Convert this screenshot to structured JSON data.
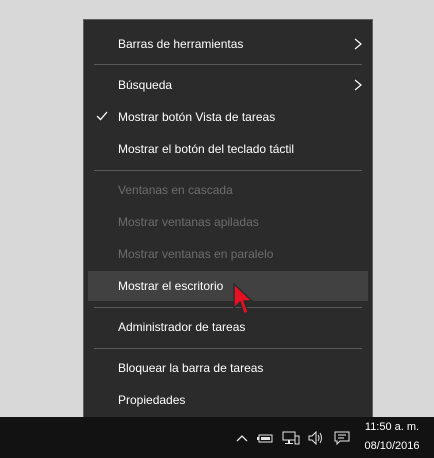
{
  "menu": {
    "items": [
      {
        "label": "Barras de herramientas",
        "submenu": true
      },
      {
        "label": "Búsqueda",
        "submenu": true
      },
      {
        "label": "Mostrar botón Vista de tareas",
        "checked": true
      },
      {
        "label": "Mostrar el botón del teclado táctil"
      },
      {
        "label": "Ventanas en cascada",
        "disabled": true
      },
      {
        "label": "Mostrar ventanas apiladas",
        "disabled": true
      },
      {
        "label": "Mostrar ventanas en paralelo",
        "disabled": true
      },
      {
        "label": "Mostrar el escritorio",
        "highlighted": true
      },
      {
        "label": "Administrador de tareas"
      },
      {
        "label": "Bloquear la barra de tareas"
      },
      {
        "label": "Propiedades"
      }
    ]
  },
  "taskbar": {
    "clock": {
      "time": "11:50 a. m.",
      "date": "08/10/2016"
    },
    "tray_icons": [
      "chevron-up-icon",
      "battery-icon",
      "network-icon",
      "volume-icon",
      "notifications-icon"
    ]
  },
  "colors": {
    "menu_bg": "#2b2b2b",
    "highlight_bg": "#414141",
    "disabled_text": "#6d6d6d",
    "cursor": "#e81123"
  }
}
